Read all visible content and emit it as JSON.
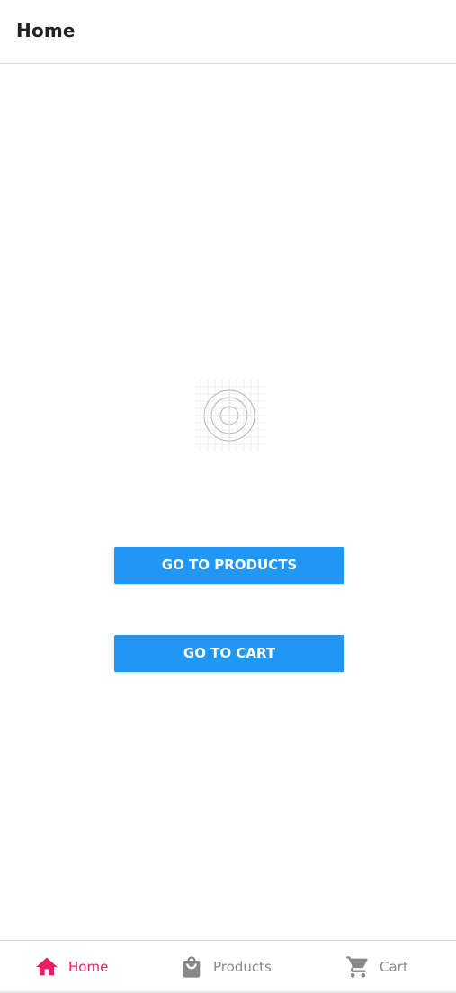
{
  "header": {
    "title": "Home"
  },
  "main": {
    "placeholder_icon": "image-placeholder-icon",
    "buttons": {
      "products_label": "GO TO PRODUCTS",
      "cart_label": "GO TO CART"
    }
  },
  "tabbar": {
    "items": [
      {
        "label": "Home",
        "icon": "home-icon",
        "active": true
      },
      {
        "label": "Products",
        "icon": "shopping-bag-icon",
        "active": false
      },
      {
        "label": "Cart",
        "icon": "cart-icon",
        "active": false
      }
    ]
  },
  "colors": {
    "accent": "#e91e63",
    "button": "#2196f3",
    "inactive": "#888888"
  }
}
